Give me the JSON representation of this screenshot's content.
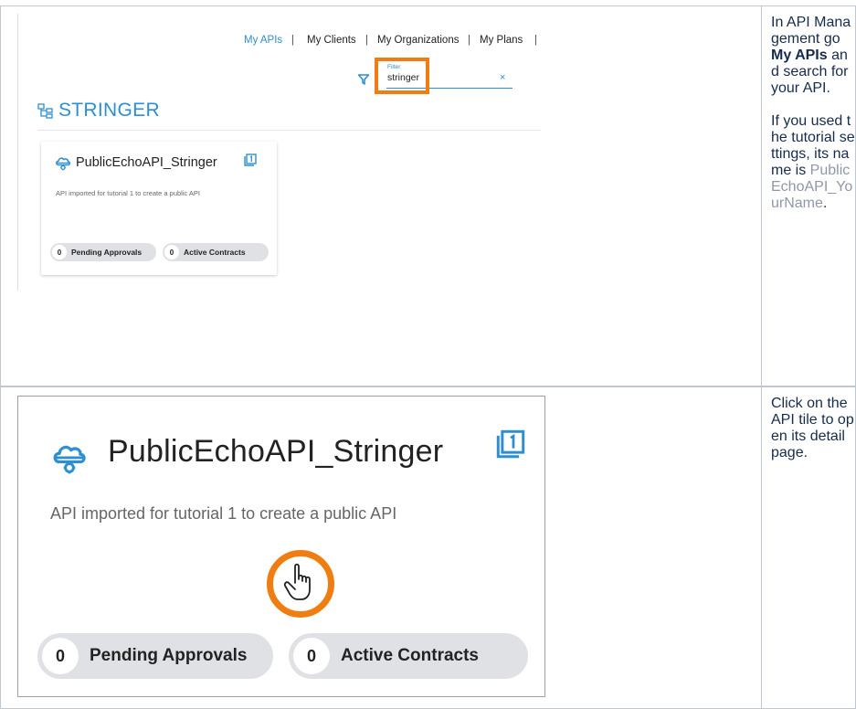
{
  "row1": {
    "screenshot": {
      "nav": {
        "items": [
          "My APIs",
          "My Clients",
          "My Organizations",
          "My Plans"
        ],
        "separator": "|"
      },
      "filter": {
        "label": "Filter",
        "value": "stringer",
        "clear": "×"
      },
      "org_title": "STRINGER",
      "tile": {
        "name": "PublicEchoAPI_Stringer",
        "description": "API imported for tutorial 1 to create a public API",
        "pending_count": "0",
        "pending_label": "Pending Approvals",
        "active_count": "0",
        "active_label": "Active Contracts"
      }
    },
    "text": {
      "p1_before": "In API Management go ",
      "p1_bold": "My APIs",
      "p1_after": " and search for your API.",
      "p2_before": "If you used the tutorial settings, its name is ",
      "p2_code": "PublicEchoAPI_YourName",
      "p2_after": "."
    }
  },
  "row2": {
    "screenshot": {
      "tile": {
        "name": "PublicEchoAPI_Stringer",
        "description": "API imported for tutorial 1 to create a public API",
        "pending_count": "0",
        "pending_label": "Pending Approvals",
        "active_count": "0",
        "active_label": "Active Contracts"
      }
    },
    "text": "Click on the API tile to open its detail page."
  },
  "colors": {
    "accent_blue": "#2d8fd0",
    "highlight_orange": "#f07d12",
    "border": "#c1c7d0"
  },
  "icons": [
    "filter-funnel-icon",
    "organization-tree-icon",
    "cloud-api-icon",
    "count-badge-icon",
    "hand-pointer-icon",
    "close-icon"
  ]
}
